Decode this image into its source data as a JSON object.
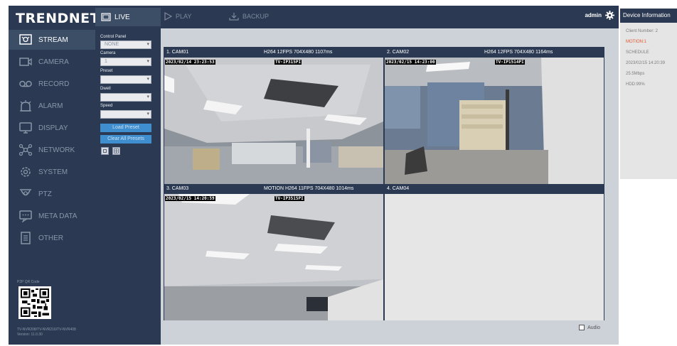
{
  "brand": {
    "logo": "TRENDNET",
    "trademark": "®"
  },
  "sidebar": {
    "items": [
      {
        "label": "STREAM",
        "icon": "stream-icon",
        "active": true
      },
      {
        "label": "CAMERA",
        "icon": "camera-icon",
        "active": false
      },
      {
        "label": "RECORD",
        "icon": "record-icon",
        "active": false
      },
      {
        "label": "ALARM",
        "icon": "alarm-icon",
        "active": false
      },
      {
        "label": "DISPLAY",
        "icon": "display-icon",
        "active": false
      },
      {
        "label": "NETWORK",
        "icon": "network-icon",
        "active": false
      },
      {
        "label": "SYSTEM",
        "icon": "system-icon",
        "active": false
      },
      {
        "label": "PTZ",
        "icon": "ptz-icon",
        "active": false
      },
      {
        "label": "META DATA",
        "icon": "meta-data-icon",
        "active": false
      },
      {
        "label": "OTHER",
        "icon": "other-icon",
        "active": false
      }
    ],
    "qr_label": "P2P QR Code",
    "model_line1": "TV-NVR208/TV-NVR216/TV-NVR408",
    "model_line2": "Version: 11.0.30"
  },
  "control_panel": {
    "tab_label": "LIVE",
    "heading": "Control Panel",
    "control_panel_value": "NONE",
    "camera_label": "Camera",
    "camera_value": "1",
    "preset_label": "Preset",
    "preset_value": "",
    "dwell_label": "Dwell",
    "dwell_value": "",
    "speed_label": "Speed",
    "speed_value": "",
    "load_preset": "Load Preset",
    "clear_preset": "Clear All Presets"
  },
  "topbar": {
    "play_label": "PLAY",
    "backup_label": "BACKUP",
    "user": "admin"
  },
  "cameras": [
    {
      "name": "1. CAM01",
      "info": "H264 12FPS 704X480 1107ms",
      "timestamp": "2023/02/14 23:23:53",
      "osd_name": "TV-IP315PI"
    },
    {
      "name": "2. CAM02",
      "info": "H264 12FPS 704X480 1164ms",
      "timestamp": "2023/02/15 14:23:00",
      "osd_name": "TV-IP1514PI"
    },
    {
      "name": "3. CAM03",
      "info": "MOTION H264 11FPS 704X480 1014ms",
      "timestamp": "2023/02/15 14:20:59",
      "osd_name": "TV-IP3515PI"
    },
    {
      "name": "4. CAM04",
      "info": "",
      "timestamp": "",
      "osd_name": ""
    }
  ],
  "audio_label": "Audio",
  "device_info": {
    "title": "Device Information",
    "client_number": "Client Number: 2",
    "motion": "MOTION:1",
    "schedule": "SCHEDULE",
    "datetime": "2023/02/15 14:20:39",
    "bitrate": "25.5Mbps",
    "hdd": "HDD:99%"
  },
  "colors": {
    "navy": "#2b3a52",
    "active_nav": "#3c4d66",
    "button_blue": "#3e8ed0",
    "alert": "#e4572e"
  }
}
